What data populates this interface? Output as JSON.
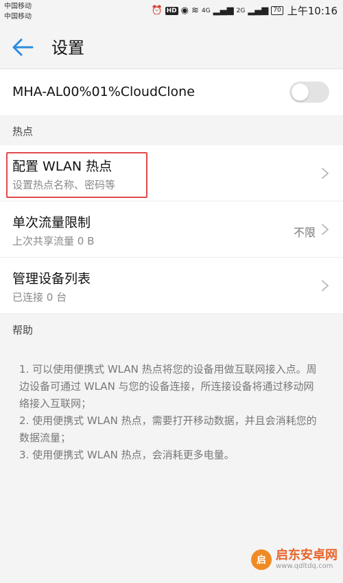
{
  "status_bar": {
    "carrier1": "中国移动",
    "carrier2": "中国移动",
    "hd": "HD",
    "net1": "4G",
    "net2": "2G",
    "battery": "70",
    "time": "上午10:16"
  },
  "app_bar": {
    "title": "设置",
    "back_icon": "arrow-left-icon"
  },
  "hotspot_toggle": {
    "label": "MHA-AL00%01%CloudClone",
    "state": "off"
  },
  "sections": {
    "hotspot": "热点",
    "help": "帮助"
  },
  "items": [
    {
      "title": "配置 WLAN 热点",
      "subtitle": "设置热点名称、密码等",
      "value": ""
    },
    {
      "title": "单次流量限制",
      "subtitle": "上次共享流量 0 B",
      "value": "不限"
    },
    {
      "title": "管理设备列表",
      "subtitle": "已连接 0 台",
      "value": ""
    }
  ],
  "help_text": [
    "1. 可以使用便携式 WLAN 热点将您的设备用做互联网接入点。周边设备可通过 WLAN 与您的设备连接，所连接设备将通过移动网络接入互联网；",
    "2. 使用便携式 WLAN 热点，需要打开移动数据，并且会消耗您的数据流量；",
    "3. 使用便携式 WLAN 热点，会消耗更多电量。"
  ],
  "watermark": {
    "name": "启东安卓网",
    "url": "www.qdltdq.com",
    "logo": "启"
  },
  "colors": {
    "accent": "#2a8de0",
    "highlight_border": "#e04a4a",
    "background": "#f4f4f4"
  }
}
